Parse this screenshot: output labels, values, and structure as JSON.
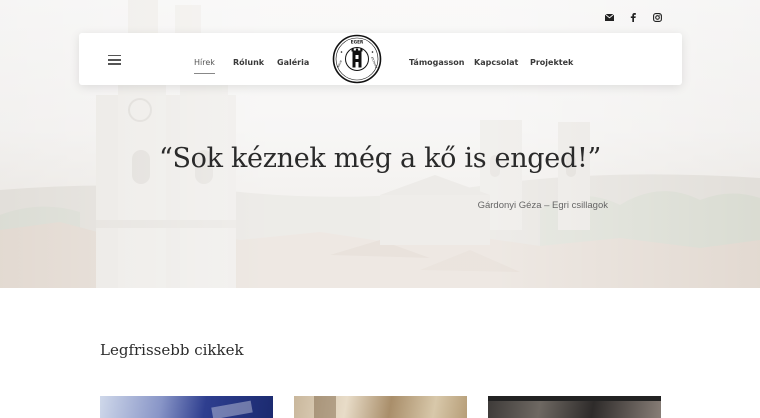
{
  "header": {
    "social_icons": [
      "envelope-icon",
      "facebook-icon",
      "instagram-icon"
    ],
    "menu_icon": "hamburger-icon",
    "nav_left": [
      {
        "label": "Hírek",
        "active": true
      },
      {
        "label": "Rólunk",
        "active": false
      },
      {
        "label": "Galéria",
        "active": false
      }
    ],
    "nav_right": [
      {
        "label": "Támogasson",
        "active": false
      },
      {
        "label": "Kapcsolat",
        "active": false
      },
      {
        "label": "Projektek",
        "active": false
      }
    ],
    "logo": {
      "icon": "tower-seal-icon",
      "text_top": "EGER",
      "text_bottom": "INKUBÁTORHÁZ"
    }
  },
  "hero": {
    "quote": "“Sok kéznek még a kő is enged!”",
    "author": "Gárdonyi Géza – Egri csillagok"
  },
  "articles": {
    "title": "Legfrissebb cikkek",
    "cards": [
      {
        "name": "article-card-1"
      },
      {
        "name": "article-card-2"
      },
      {
        "name": "article-card-3"
      }
    ]
  },
  "colors": {
    "nav_text": "#3a3a3a",
    "heading_text": "#2a2a2a",
    "muted_text": "#666666",
    "background": "#ffffff"
  }
}
